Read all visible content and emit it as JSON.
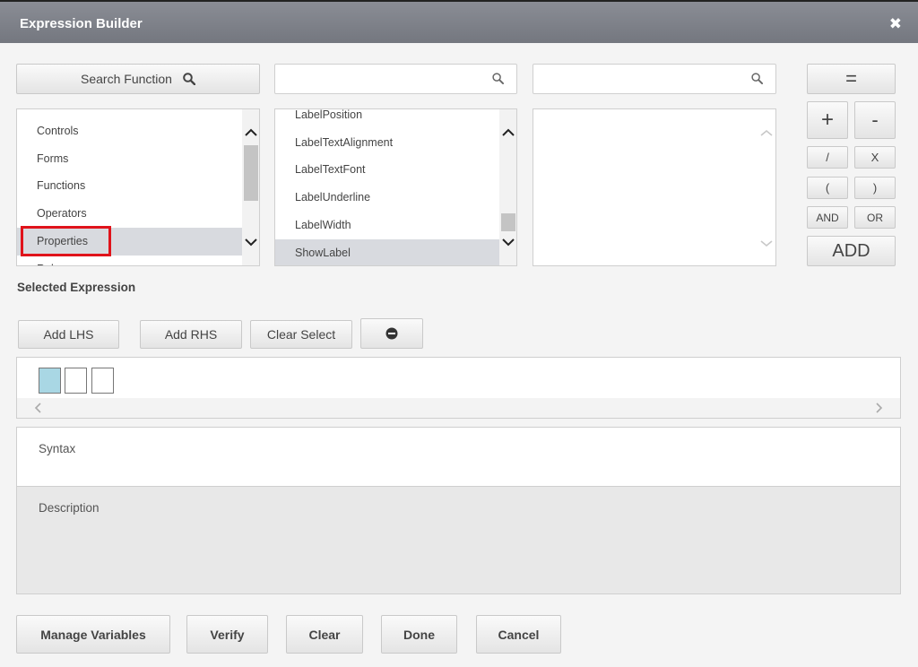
{
  "window": {
    "title": "Expression Builder",
    "close_glyph": "✖"
  },
  "search_function": {
    "label": "Search Function",
    "icon": "search-icon"
  },
  "search2": {
    "value": "",
    "placeholder": ""
  },
  "search3": {
    "value": "",
    "placeholder": ""
  },
  "categories": {
    "items": [
      {
        "label": "Controls"
      },
      {
        "label": "Forms"
      },
      {
        "label": "Functions"
      },
      {
        "label": "Operators"
      },
      {
        "label": "Properties"
      },
      {
        "label": "Rules"
      }
    ],
    "selected": "Properties"
  },
  "members": {
    "items": [
      {
        "label": "LabelPosition"
      },
      {
        "label": "LabelTextAlignment"
      },
      {
        "label": "LabelTextFont"
      },
      {
        "label": "LabelUnderline"
      },
      {
        "label": "LabelWidth"
      },
      {
        "label": "ShowLabel"
      }
    ],
    "selected": "ShowLabel"
  },
  "operators": {
    "equals": "=",
    "plus": "+",
    "minus": "-",
    "divide": "/",
    "multiply": "X",
    "open_paren": "(",
    "close_paren": ")",
    "and": "AND",
    "or": "OR",
    "add": "ADD"
  },
  "selected_expression": {
    "label": "Selected Expression",
    "add_lhs": "Add LHS",
    "add_rhs": "Add RHS",
    "clear_select": "Clear Select",
    "remove_icon": "minus-circle-icon"
  },
  "syntax": {
    "label": "Syntax"
  },
  "description": {
    "label": "Description"
  },
  "footer": {
    "manage_variables": "Manage Variables",
    "verify": "Verify",
    "clear": "Clear",
    "done": "Done",
    "cancel": "Cancel"
  },
  "colors": {
    "titlebar": "#7d8088",
    "selection": "#d8dadf",
    "active_slot": "#a9d7e4",
    "highlight_box": "#e0131b"
  }
}
